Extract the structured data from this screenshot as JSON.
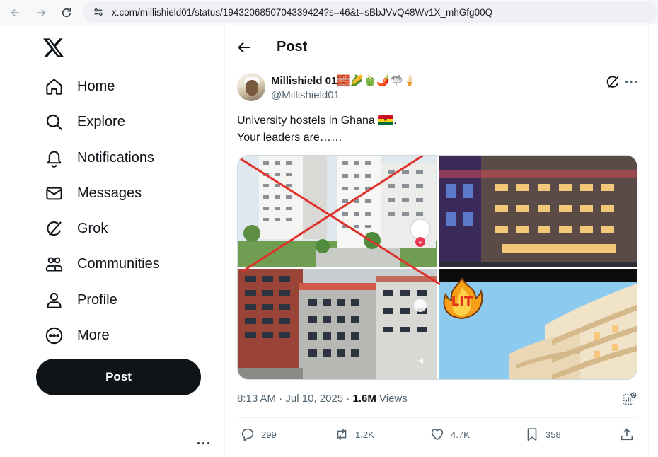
{
  "browser": {
    "url": "x.com/millishield01/status/1943206850704339424?s=46&t=sBbJVvQ48Wv1X_mhGfg00Q"
  },
  "sidebar": {
    "items": [
      {
        "label": "Home",
        "icon": "home-icon"
      },
      {
        "label": "Explore",
        "icon": "search-icon"
      },
      {
        "label": "Notifications",
        "icon": "bell-icon"
      },
      {
        "label": "Messages",
        "icon": "envelope-icon"
      },
      {
        "label": "Grok",
        "icon": "grok-icon"
      },
      {
        "label": "Communities",
        "icon": "people-icon"
      },
      {
        "label": "Profile",
        "icon": "person-icon"
      },
      {
        "label": "More",
        "icon": "more-circle-icon"
      }
    ],
    "post_button": "Post",
    "more_dots": "···"
  },
  "header": {
    "title": "Post"
  },
  "tweet": {
    "display_name": "Millishield 01🧱🌽🫑🌶️🦈🍦",
    "handle": "@Millishield01",
    "text_line1": "University hostels in Ghana",
    "text_line1_end": ".",
    "text_line2": "Your leaders are……",
    "sticker_text": "LIT",
    "time": "8:13 AM",
    "date": "Jul 10, 2025",
    "views_count": "1.6M",
    "views_label": "Views",
    "replies": "299",
    "reposts": "1.2K",
    "likes": "4.7K",
    "bookmarks": "358"
  },
  "colors": {
    "text": "#0f1419",
    "muted": "#536471",
    "cross": "#e0312b"
  }
}
